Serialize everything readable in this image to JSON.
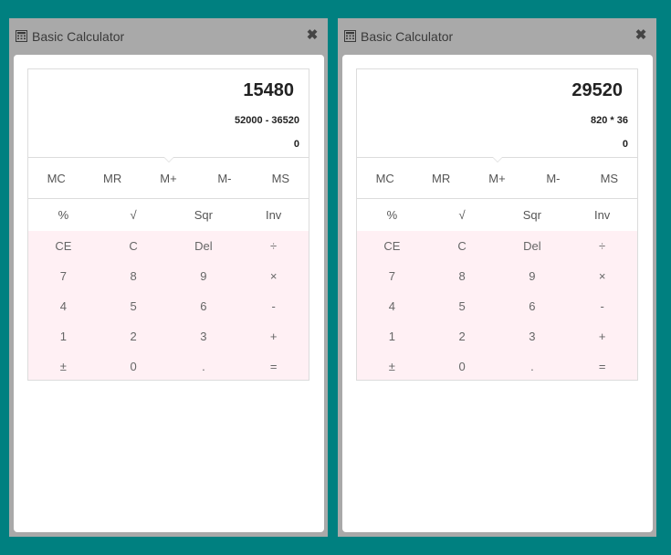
{
  "windows": [
    {
      "title": "Basic Calculator",
      "close_label": "✖",
      "display": {
        "result": "15480",
        "expression": "52000 - 36520",
        "memory": "0"
      },
      "memory_buttons": [
        "MC",
        "MR",
        "M+",
        "M-",
        "MS"
      ],
      "function_buttons": [
        "%",
        "√",
        "Sqr",
        "Inv"
      ],
      "keys": [
        "CE",
        "C",
        "Del",
        "÷",
        "7",
        "8",
        "9",
        "×",
        "4",
        "5",
        "6",
        "-",
        "1",
        "2",
        "3",
        "+",
        "±",
        "0",
        ".",
        "="
      ]
    },
    {
      "title": "Basic Calculator",
      "close_label": "✖",
      "display": {
        "result": "29520",
        "expression": "820 * 36",
        "memory": "0"
      },
      "memory_buttons": [
        "MC",
        "MR",
        "M+",
        "M-",
        "MS"
      ],
      "function_buttons": [
        "%",
        "√",
        "Sqr",
        "Inv"
      ],
      "keys": [
        "CE",
        "C",
        "Del",
        "÷",
        "7",
        "8",
        "9",
        "×",
        "4",
        "5",
        "6",
        "-",
        "1",
        "2",
        "3",
        "+",
        "±",
        "0",
        ".",
        "="
      ]
    }
  ],
  "colors": {
    "desktop": "#008080",
    "window_frame": "#a9a9a9",
    "keypad_bg": "#fff0f4"
  },
  "icons": {
    "title": "calculator-icon",
    "close": "close-icon"
  }
}
